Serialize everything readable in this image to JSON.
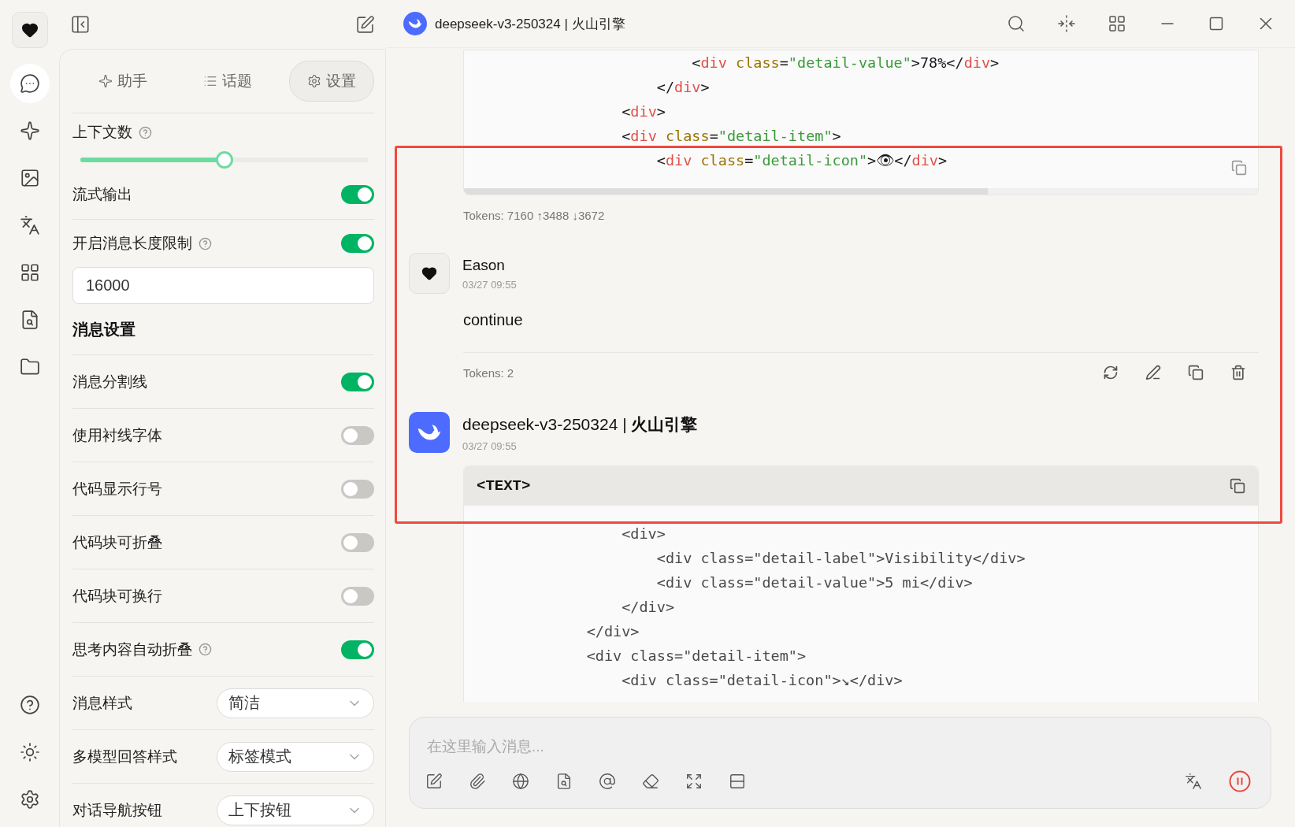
{
  "rail_items": [
    {
      "selected": false
    },
    {
      "selected": true
    },
    {
      "selected": false
    },
    {
      "selected": false
    },
    {
      "selected": false
    },
    {
      "selected": false
    },
    {
      "selected": false
    },
    {
      "selected": false
    }
  ],
  "tabs": [
    {
      "label": "助手",
      "selected": false
    },
    {
      "label": "话题",
      "selected": false
    },
    {
      "label": "设置",
      "selected": true
    }
  ],
  "settings": [
    {
      "kind": "slider",
      "label": "上下文数",
      "help": true,
      "level": 0.5
    },
    {
      "kind": "toggle",
      "label": "流式输出",
      "help": false,
      "on": true
    },
    {
      "kind": "toggle",
      "label": "开启消息长度限制",
      "help": true,
      "on": true
    },
    {
      "kind": "input",
      "value": "16000"
    },
    {
      "kind": "heading",
      "label": "消息设置"
    },
    {
      "kind": "toggle",
      "label": "消息分割线",
      "help": false,
      "on": true
    },
    {
      "kind": "toggle",
      "label": "使用衬线字体",
      "help": false,
      "on": false
    },
    {
      "kind": "toggle",
      "label": "代码显示行号",
      "help": false,
      "on": false
    },
    {
      "kind": "toggle",
      "label": "代码块可折叠",
      "help": false,
      "on": false
    },
    {
      "kind": "toggle",
      "label": "代码块可换行",
      "help": false,
      "on": false
    },
    {
      "kind": "toggle",
      "label": "思考内容自动折叠",
      "help": true,
      "on": true
    },
    {
      "kind": "select",
      "label": "消息样式",
      "help": false,
      "value": "简洁"
    },
    {
      "kind": "select",
      "label": "多模型回答样式",
      "help": false,
      "value": "标签模式"
    },
    {
      "kind": "select",
      "label": "对话导航按钮",
      "help": false,
      "value": "上下按钮"
    }
  ],
  "window": {
    "title": "deepseek-v3-250324 | 火山引擎"
  },
  "messages": [
    {
      "kind": "tail",
      "tokens": "Tokens: 7160 ↑3488 ↓3672",
      "code": {
        "highlighted": true,
        "lines": [
          "                        <div class=\"detail-value\">78%</div>",
          "                    </div>",
          "                <div>",
          "                <div class=\"detail-item\">",
          "                    <div class=\"detail-icon\">👁</div>"
        ]
      }
    },
    {
      "kind": "user",
      "name": "Eason",
      "time": "03/27 09:55",
      "text": "continue",
      "tokens": "Tokens: 2"
    },
    {
      "kind": "assistant",
      "name": "deepseek-v3-250324 | **火山引擎**",
      "time": "03/27 09:55",
      "code": {
        "highlighted": false,
        "language": "<TEXT>",
        "lines": [
          "                <div>",
          "                    <div class=\"detail-label\">Visibility</div>",
          "                    <div class=\"detail-value\">5 mi</div>",
          "                </div>",
          "            </div>",
          "            <div class=\"detail-item\">",
          "                <div class=\"detail-icon\">↘</div>"
        ]
      }
    }
  ],
  "composer": {
    "placeholder": "在这里输入消息..."
  }
}
